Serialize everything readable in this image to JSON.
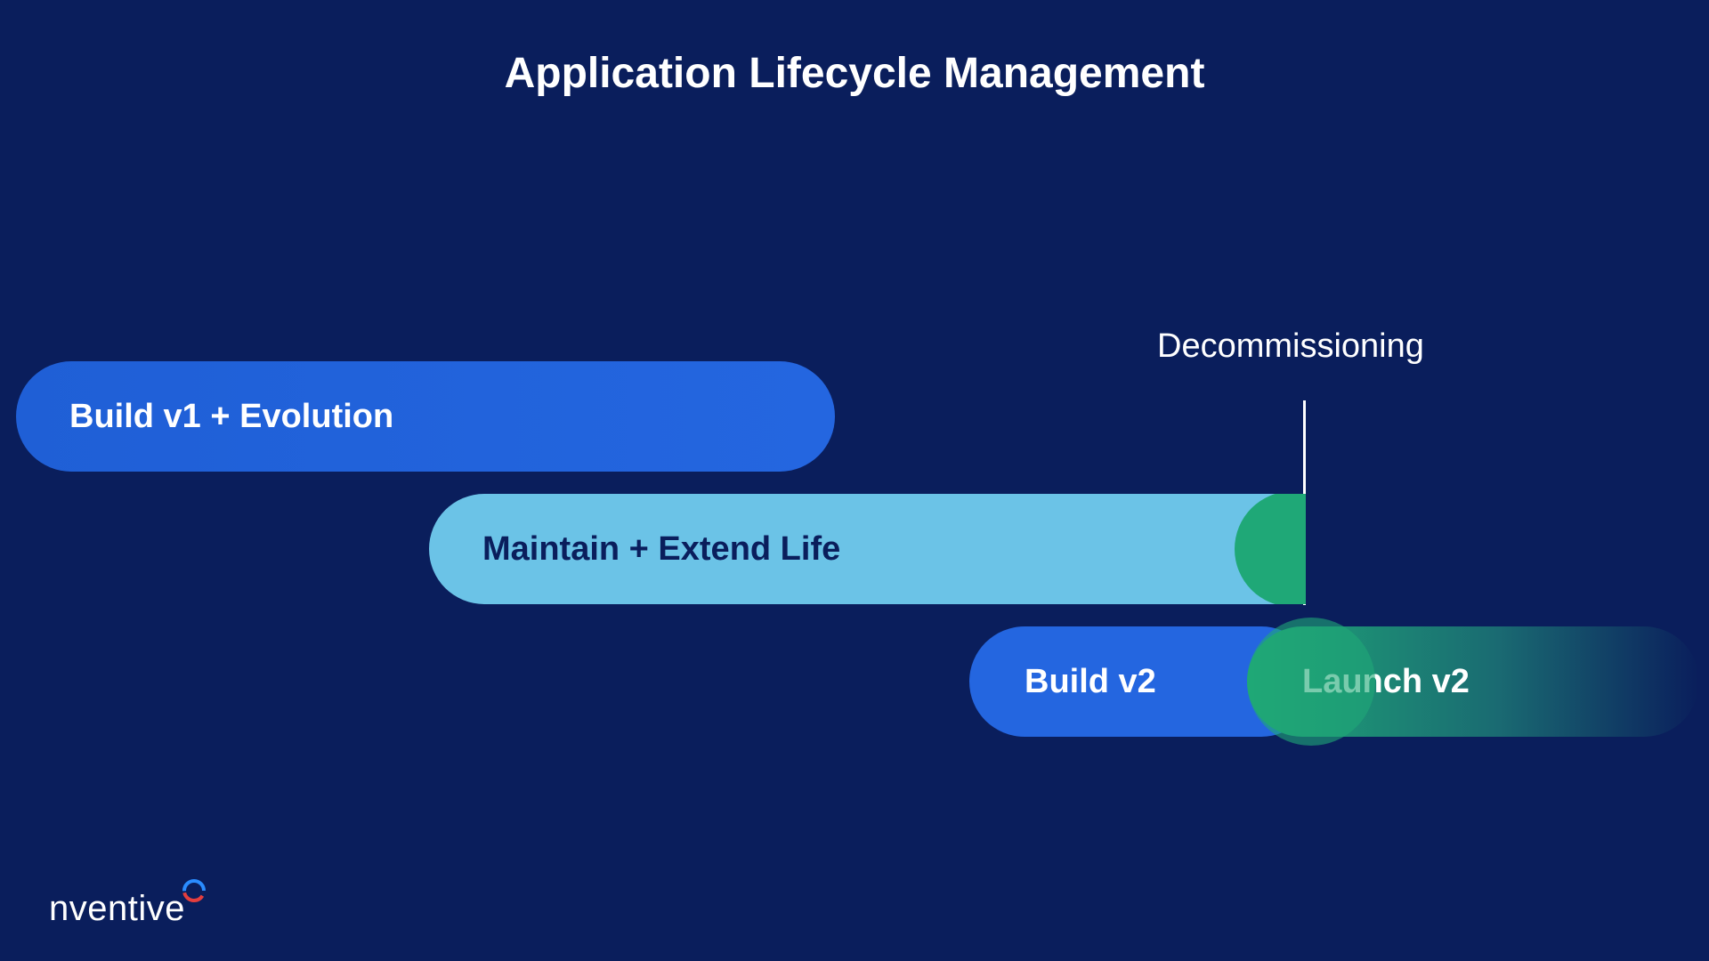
{
  "title": "Application Lifecycle Management",
  "decommissioning_label": "Decommissioning",
  "bars": {
    "build_v1": "Build v1 + Evolution",
    "maintain": "Maintain + Extend Life",
    "build_v2": "Build v2",
    "launch_v2": "Launch v2"
  },
  "logo": {
    "text": "nventive"
  }
}
